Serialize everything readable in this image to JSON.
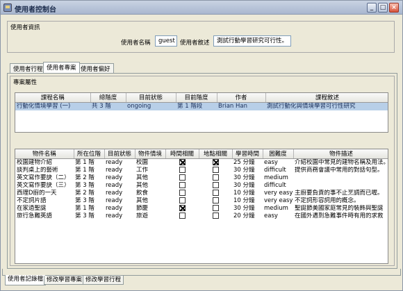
{
  "window": {
    "title": "使用者控制台"
  },
  "user_info": {
    "group_title": "使用者資訊",
    "name_label": "使用者名稱",
    "name_value": "guest",
    "desc_label": "使用者敘述",
    "desc_value": "測試行動學習研究可行性。"
  },
  "tabs": [
    "使用者行程",
    "使用者專案",
    "使用者偏好"
  ],
  "project_panel": {
    "group_title": "專案屬性",
    "columns": [
      "課程名稱",
      "總階度",
      "目前狀態",
      "目前階度",
      "作者",
      "課程敘述"
    ],
    "rows": [
      [
        "行動化情境學習 (一)",
        "共 3 階",
        "ongoing",
        "第 1 階段",
        "Brian Han",
        "測試行動化與情境學習可行性研究"
      ]
    ]
  },
  "object_table": {
    "columns": [
      "物件名稱",
      "所在位階",
      "目前狀態",
      "物件情境",
      "時間相關",
      "地點相關",
      "學習時間",
      "困難度",
      "物件描述"
    ],
    "rows": [
      {
        "name": "校園建物介紹",
        "level": "第 1 階",
        "status": "ready",
        "context": "校園",
        "time": true,
        "place": true,
        "duration": "25 分鐘",
        "difficulty": "easy",
        "desc": "介紹校園中常見的建物名稱及用法。"
      },
      {
        "name": "談判桌上的藝術",
        "level": "第 1 階",
        "status": "ready",
        "context": "工作",
        "time": false,
        "place": false,
        "duration": "30 分鐘",
        "difficulty": "difficult",
        "desc": "提供商務會議中常用的對話句型。"
      },
      {
        "name": "英文寫作要訣（二）",
        "level": "第 2 階",
        "status": "ready",
        "context": "其他",
        "time": false,
        "place": false,
        "duration": "30 分鐘",
        "difficulty": "medium",
        "desc": ""
      },
      {
        "name": "英文寫作要訣（三）",
        "level": "第 3 階",
        "status": "ready",
        "context": "其他",
        "time": false,
        "place": false,
        "duration": "30 分鐘",
        "difficulty": "difficult",
        "desc": ""
      },
      {
        "name": "西理D廚的一天",
        "level": "第 2 階",
        "status": "ready",
        "context": "飲食",
        "time": false,
        "place": false,
        "duration": "10 分鐘",
        "difficulty": "very easy",
        "desc": "主廚要負責的事不止烹調而已喔。"
      },
      {
        "name": "不定詞片語",
        "level": "第 3 階",
        "status": "ready",
        "context": "其他",
        "time": false,
        "place": false,
        "duration": "10 分鐘",
        "difficulty": "very easy",
        "desc": "不定詞形容詞用的概念。"
      },
      {
        "name": "在家過聖誕",
        "level": "第 1 階",
        "status": "ready",
        "context": "節慶",
        "time": true,
        "place": false,
        "duration": "30 分鐘",
        "difficulty": "medium",
        "desc": "聖誕節美國家庭常見的裝飾與聖誕"
      },
      {
        "name": "旅行急難英語",
        "level": "第 3 階",
        "status": "ready",
        "context": "旅遊",
        "time": false,
        "place": false,
        "duration": "20 分鐘",
        "difficulty": "easy",
        "desc": "在國外遇到急難事件時有用的求救"
      }
    ]
  },
  "bottom_tabs": [
    "使用者記錄檔",
    "修改學習專案",
    "修改學習行程"
  ]
}
